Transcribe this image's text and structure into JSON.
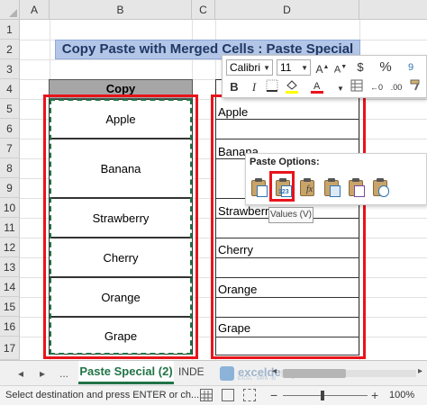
{
  "columns": [
    "A",
    "B",
    "C",
    "D"
  ],
  "rows": [
    "1",
    "2",
    "3",
    "4",
    "5",
    "6",
    "7",
    "8",
    "9",
    "10",
    "11",
    "12",
    "13",
    "14",
    "15",
    "16",
    "17"
  ],
  "title": "Copy Paste with Merged Cells : Paste Special",
  "copy_header": "Copy",
  "copy_values": [
    "Apple",
    "Banana",
    "Strawberry",
    "Cherry",
    "Orange",
    "Grape"
  ],
  "paste_values": [
    "Apple",
    "Banana",
    "Strawberry",
    "Cherry",
    "Orange",
    "Grape"
  ],
  "mini_toolbar": {
    "font": "Calibri",
    "size": "11",
    "bold": "B",
    "italic": "I",
    "percent": "%",
    "currency": "$",
    "comma": "9"
  },
  "paste_options": {
    "title": "Paste Options:",
    "tooltip": "Values (V)",
    "values_badge": "123",
    "formula_badge": "fx"
  },
  "tabs": {
    "prev": "◂",
    "next": "▸",
    "ellipsis": "...",
    "active": "Paste Special (2)",
    "other": "INDE"
  },
  "watermark": {
    "name": "exceldemy",
    "tagline": "EXCEL · DATA · BI"
  },
  "status": {
    "message": "Select destination and press ENTER or ch...",
    "zoom": "100%"
  },
  "colors": {
    "accent_green": "#217346",
    "highlight_red": "#e8141b",
    "title_fill": "#b4c6e7"
  }
}
